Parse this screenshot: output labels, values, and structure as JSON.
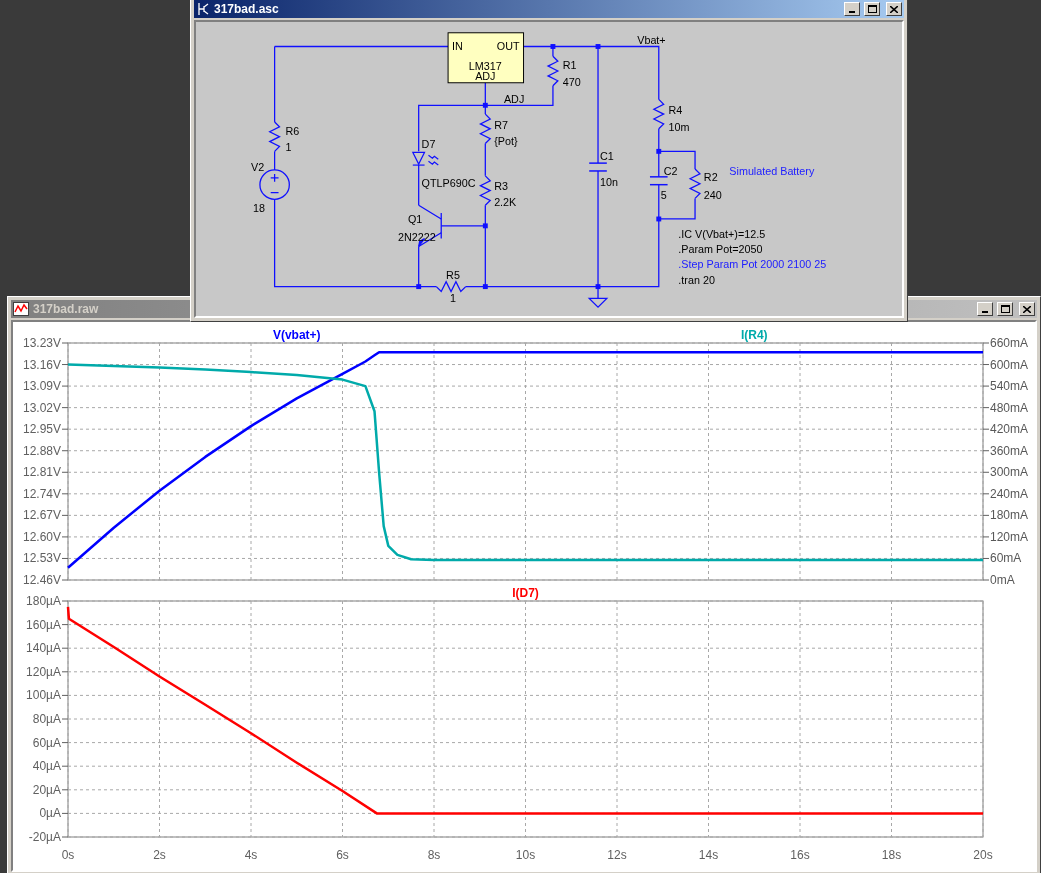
{
  "waveform_window": {
    "title": "317bad.raw",
    "active": false,
    "panes": [
      {
        "layers": [
          {
            "chart_data": {
              "type": "line",
              "grid": true,
              "x": [
                0,
                1,
                2,
                3,
                4,
                5,
                6,
                6.5,
                6.7,
                6.8,
                6.9,
                7,
                7.2,
                7.5,
                8,
                10,
                12,
                14,
                16,
                18,
                20
              ],
              "xlim": [
                0,
                20
              ],
              "ylim": [
                12.46,
                13.23
              ],
              "yticks": [
                {
                  "value": 12.46,
                  "label": "12.46V"
                },
                {
                  "value": 12.53,
                  "label": "12.53V"
                },
                {
                  "value": 12.6,
                  "label": "12.60V"
                },
                {
                  "value": 12.67,
                  "label": "12.67V"
                },
                {
                  "value": 12.74,
                  "label": "12.74V"
                },
                {
                  "value": 12.81,
                  "label": "12.81V"
                },
                {
                  "value": 12.88,
                  "label": "12.88V"
                },
                {
                  "value": 12.95,
                  "label": "12.95V"
                },
                {
                  "value": 13.02,
                  "label": "13.02V"
                },
                {
                  "value": 13.09,
                  "label": "13.09V"
                },
                {
                  "value": 13.16,
                  "label": "13.16V"
                },
                {
                  "value": 13.23,
                  "label": "13.23V"
                }
              ],
              "series": [
                {
                  "name": "V(vbat+)",
                  "color": "#0000ff",
                  "values": [
                    12.5,
                    12.63,
                    12.75,
                    12.86,
                    12.96,
                    13.05,
                    13.13,
                    13.17,
                    13.19,
                    13.2,
                    13.2,
                    13.2,
                    13.2,
                    13.2,
                    13.2,
                    13.2,
                    13.2,
                    13.2,
                    13.2,
                    13.2,
                    13.2
                  ]
                }
              ]
            }
          },
          {
            "chart_data": {
              "type": "line",
              "x": [
                0,
                1,
                2,
                3,
                4,
                5,
                6,
                6.5,
                6.7,
                6.8,
                6.9,
                7,
                7.2,
                7.5,
                8,
                10,
                12,
                14,
                16,
                18,
                20
              ],
              "xlim": [
                0,
                20
              ],
              "ylim": [
                0,
                660
              ],
              "yticks": [
                {
                  "value": 0,
                  "label": "0mA"
                },
                {
                  "value": 60,
                  "label": "60mA"
                },
                {
                  "value": 120,
                  "label": "120mA"
                },
                {
                  "value": 180,
                  "label": "180mA"
                },
                {
                  "value": 240,
                  "label": "240mA"
                },
                {
                  "value": 300,
                  "label": "300mA"
                },
                {
                  "value": 360,
                  "label": "360mA"
                },
                {
                  "value": 420,
                  "label": "420mA"
                },
                {
                  "value": 480,
                  "label": "480mA"
                },
                {
                  "value": 540,
                  "label": "540mA"
                },
                {
                  "value": 600,
                  "label": "600mA"
                },
                {
                  "value": 660,
                  "label": "660mA"
                }
              ],
              "series": [
                {
                  "name": "I(R4)",
                  "color": "#00aaaa",
                  "values": [
                    600,
                    596,
                    592,
                    586,
                    579,
                    571,
                    558,
                    540,
                    470,
                    300,
                    150,
                    95,
                    70,
                    58,
                    56,
                    56,
                    56,
                    56,
                    56,
                    56,
                    56
                  ]
                }
              ]
            }
          }
        ]
      },
      {
        "layers": [
          {
            "chart_data": {
              "type": "line",
              "grid": true,
              "x": [
                0,
                0.02,
                1,
                2,
                3,
                4,
                5,
                6,
                6.75,
                8,
                10,
                12,
                14,
                16,
                18,
                20
              ],
              "xlim": [
                0,
                20
              ],
              "xticks": [
                {
                  "value": 0,
                  "label": "0s"
                },
                {
                  "value": 2,
                  "label": "2s"
                },
                {
                  "value": 4,
                  "label": "4s"
                },
                {
                  "value": 6,
                  "label": "6s"
                },
                {
                  "value": 8,
                  "label": "8s"
                },
                {
                  "value": 10,
                  "label": "10s"
                },
                {
                  "value": 12,
                  "label": "12s"
                },
                {
                  "value": 14,
                  "label": "14s"
                },
                {
                  "value": 16,
                  "label": "16s"
                },
                {
                  "value": 18,
                  "label": "18s"
                },
                {
                  "value": 20,
                  "label": "20s"
                }
              ],
              "ylim": [
                -20,
                180
              ],
              "yticks": [
                {
                  "value": -20,
                  "label": "-20µA"
                },
                {
                  "value": 0,
                  "label": "0µA"
                },
                {
                  "value": 20,
                  "label": "20µA"
                },
                {
                  "value": 40,
                  "label": "40µA"
                },
                {
                  "value": 60,
                  "label": "60µA"
                },
                {
                  "value": 80,
                  "label": "80µA"
                },
                {
                  "value": 100,
                  "label": "100µA"
                },
                {
                  "value": 120,
                  "label": "120µA"
                },
                {
                  "value": 140,
                  "label": "140µA"
                },
                {
                  "value": 160,
                  "label": "160µA"
                },
                {
                  "value": 180,
                  "label": "180µA"
                }
              ],
              "series": [
                {
                  "name": "I(D7)",
                  "color": "#ff0000",
                  "values": [
                    175,
                    165,
                    141,
                    116,
                    92,
                    68,
                    43,
                    19,
                    0,
                    0,
                    0,
                    0,
                    0,
                    0,
                    0,
                    0
                  ]
                }
              ]
            }
          }
        ]
      }
    ]
  },
  "schematic_window": {
    "title": "317bad.asc",
    "active": true,
    "schematic": {
      "components": [
        {
          "kind": "resistor",
          "ref": "R6",
          "value": "1"
        },
        {
          "kind": "source",
          "ref": "V2",
          "value": "18"
        },
        {
          "kind": "regulator",
          "ref": "LM317",
          "pins": [
            "IN",
            "OUT",
            "ADJ"
          ]
        },
        {
          "kind": "resistor",
          "ref": "R1",
          "value": "470"
        },
        {
          "kind": "led",
          "ref": "D7",
          "value": "QTLP690C"
        },
        {
          "kind": "resistor",
          "ref": "R7",
          "value": "{Pot}"
        },
        {
          "kind": "resistor",
          "ref": "R3",
          "value": "2.2K"
        },
        {
          "kind": "transistor",
          "ref": "Q1",
          "value": "2N2222"
        },
        {
          "kind": "resistor",
          "ref": "R5",
          "value": "1"
        },
        {
          "kind": "capacitor",
          "ref": "C1",
          "value": "10n"
        },
        {
          "kind": "resistor",
          "ref": "R4",
          "value": "10m"
        },
        {
          "kind": "capacitor",
          "ref": "C2",
          "value": "5"
        },
        {
          "kind": "resistor",
          "ref": "R2",
          "value": "240"
        }
      ],
      "net_labels": [
        "Vbat+",
        "ADJ"
      ],
      "comments": [
        "Simulated Battery"
      ],
      "directives": [
        {
          "kind": "directive",
          "text": ".IC V(Vbat+)=12.5"
        },
        {
          "kind": "directive",
          "text": ".Param Pot=2050"
        },
        {
          "kind": "comment",
          "text": ".Step Param Pot 2000 2100 25"
        },
        {
          "kind": "directive",
          "text": ".tran 20"
        }
      ]
    }
  }
}
